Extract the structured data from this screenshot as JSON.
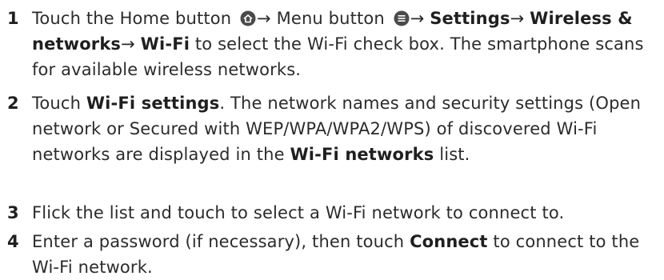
{
  "steps": [
    {
      "number": "1",
      "text1": "Touch the Home button",
      "arrow1": "→ Menu button",
      "arrow2": "→ ",
      "settings": "Settings",
      "arrow3": "→",
      "wireless": "Wireless & networks",
      "arrow4": "→ ",
      "wifi": "Wi-Fi",
      "text2": " to select the Wi-Fi check box. The smartphone scans for available wireless networks.",
      "home_icon": "home-icon",
      "menu_icon": "menu-icon"
    },
    {
      "number": "2",
      "text1": "Touch ",
      "wifi_settings": "Wi-Fi settings",
      "text2": ". The network names and security settings (Open network or Secured with WEP/WPA/WPA2/WPS) of discovered Wi-Fi networks are displayed in the ",
      "wifi_networks": "Wi-Fi networks",
      "text3": " list."
    },
    {
      "number": "3",
      "text": "Flick the list and touch to select a Wi-Fi network to connect to."
    },
    {
      "number": "4",
      "text1": "Enter a password (if necessary), then touch ",
      "connect": "Connect",
      "text2": " to connect to the Wi-Fi network."
    }
  ]
}
